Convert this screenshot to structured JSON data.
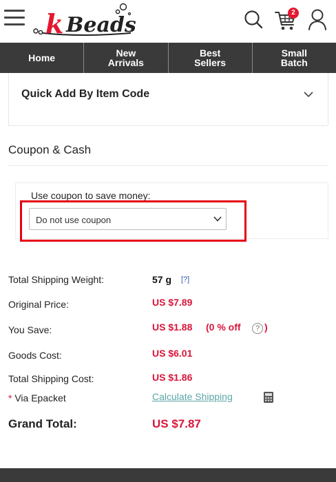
{
  "header": {
    "logo_text": "kBeads",
    "cart_count": "2",
    "icons": {
      "menu": "hamburger-menu-icon",
      "search": "search-icon",
      "cart": "shopping-cart-icon",
      "account": "user-icon"
    }
  },
  "nav": {
    "items": [
      {
        "label": "Home"
      },
      {
        "label": "New\nArrivals"
      },
      {
        "label": "Best\nSellers"
      },
      {
        "label": "Small\nBatch"
      }
    ]
  },
  "quick_add": {
    "title": "Quick Add By Item Code"
  },
  "coupon": {
    "section_title": "Coupon & Cash",
    "label": "Use coupon to save money:",
    "selected_option": "Do not use coupon"
  },
  "summary": {
    "shipping_weight_label": "Total Shipping Weight:",
    "shipping_weight_value": "57 g",
    "help_link": "[?]",
    "original_price_label": "Original Price:",
    "original_price_value": "US $7.89",
    "you_save_label": "You Save:",
    "you_save_value": "US $1.88",
    "discount_text": "(0 % off",
    "discount_close": ")",
    "goods_cost_label": "Goods Cost:",
    "goods_cost_value": "US $6.01",
    "total_shipping_label": "Total Shipping Cost:",
    "total_shipping_value": "US $1.86",
    "via_label": "Via Epacket",
    "asterisk": "*",
    "calculate_link": "Calculate Shipping",
    "grand_total_label": "Grand Total:",
    "grand_total_value": "US $7.87"
  },
  "colors": {
    "accent": "#d9153a",
    "nav_bg": "#3a3a3a",
    "highlight": "#e60012",
    "link": "#5aa5a5"
  }
}
